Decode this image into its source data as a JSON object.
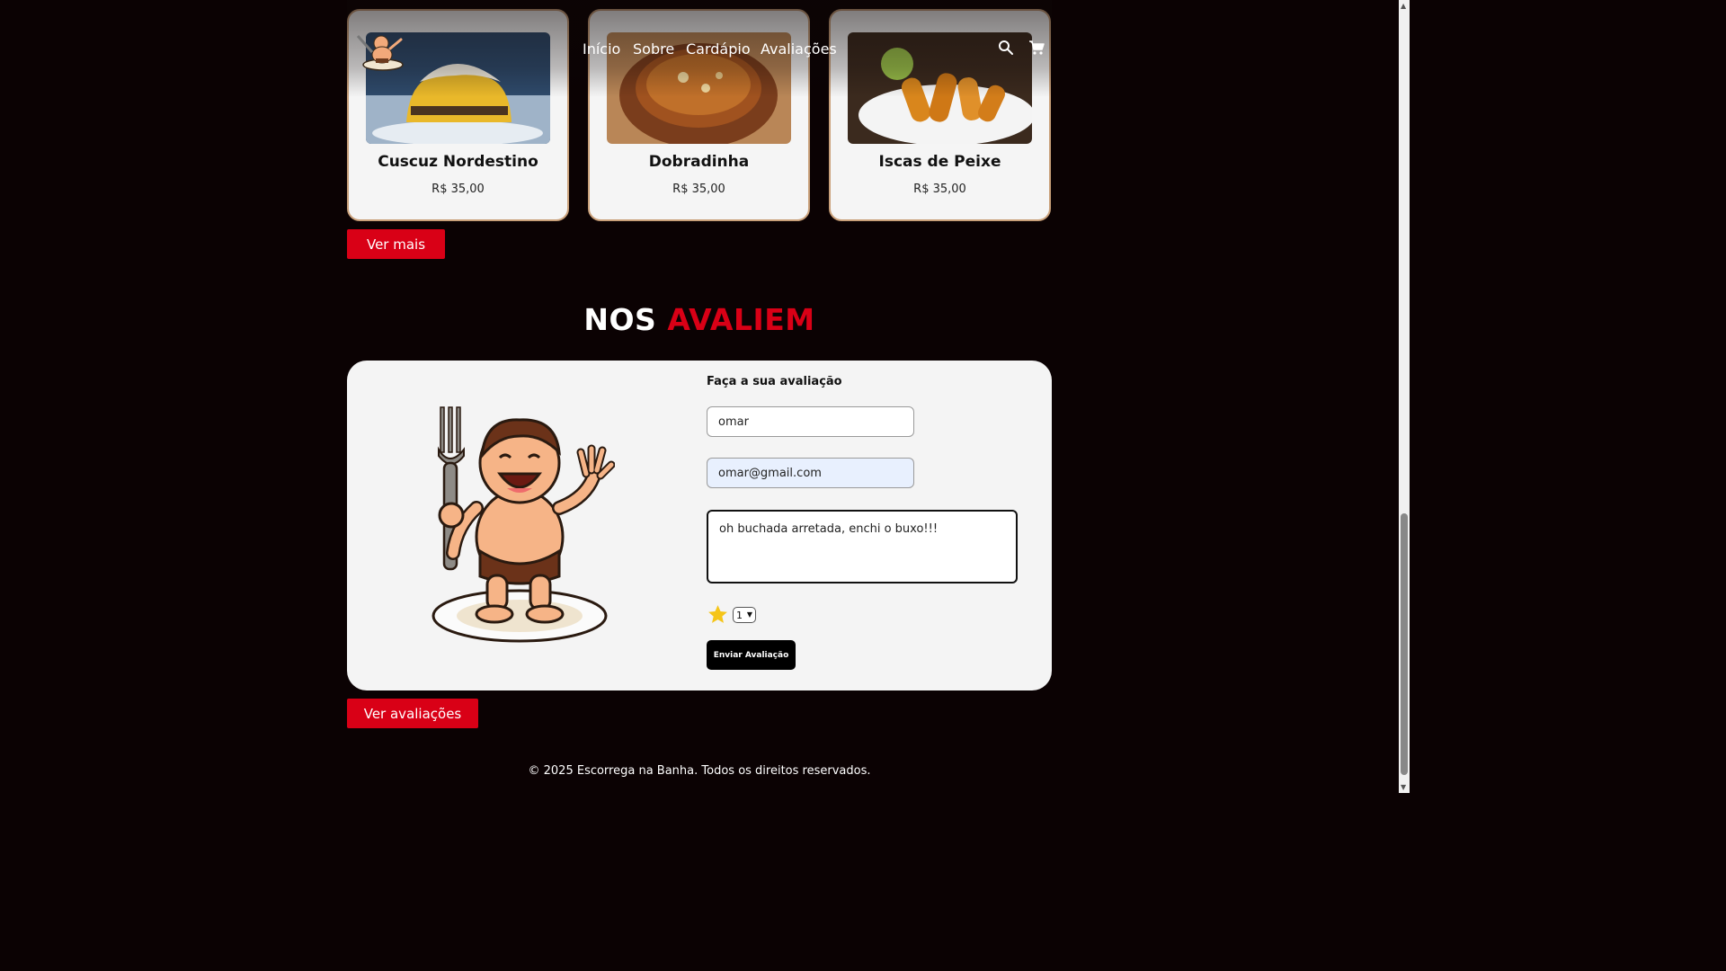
{
  "nav": {
    "links": [
      "Início",
      "Sobre",
      "Cardápio",
      "Avaliações"
    ],
    "icons": [
      "search-icon",
      "cart-icon"
    ]
  },
  "menu": {
    "items": [
      {
        "name": "Cuscuz Nordestino",
        "price": "R$ 35,00"
      },
      {
        "name": "Dobradinha",
        "price": "R$ 35,00"
      },
      {
        "name": "Iscas de Peixe",
        "price": "R$ 35,00"
      }
    ],
    "more_label": "Ver mais"
  },
  "reviews": {
    "title_part1": "NOS",
    "title_part2": "AVALIEM",
    "form_title": "Faça a sua avaliação",
    "name_value": "omar",
    "email_value": "omar@gmail.com",
    "comment_value": "oh buchada arretada, enchi o buxo!!!",
    "rating_value": "1",
    "submit_label": "Enviar Avaliação",
    "see_reviews_label": "Ver avaliações"
  },
  "footer": {
    "text": "© 2025 Escorrega na Banha. Todos os direitos reservados."
  },
  "colors": {
    "background": "#0b0203",
    "accent_red": "#d90016",
    "card_border": "#c9a07a",
    "panel": "#f4f4f4",
    "star": "#f5c518"
  }
}
